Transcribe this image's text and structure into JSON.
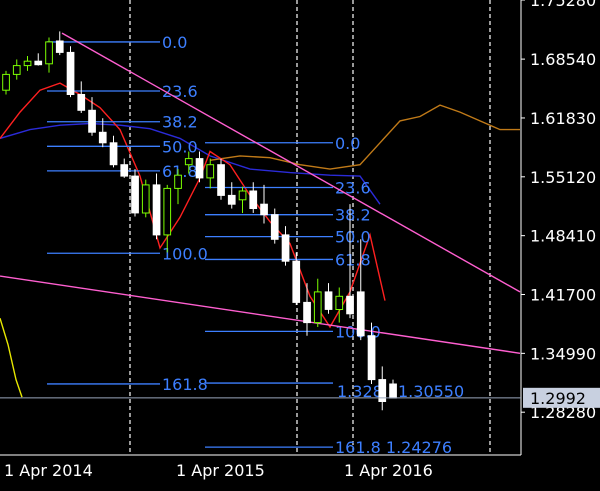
{
  "chart_data": {
    "type": "candlestick",
    "x_ticks": [
      "1 Apr 2014",
      "1 Apr 2015",
      "1 Apr 2016"
    ],
    "y_ticks": [
      "1.75280",
      "1.68540",
      "1.61830",
      "1.55120",
      "1.48410",
      "1.41700",
      "1.34990",
      "1.28280"
    ],
    "y_tick_values": [
      1.7528,
      1.6854,
      1.6183,
      1.5512,
      1.4841,
      1.417,
      1.3499,
      1.2828
    ],
    "ylim": [
      1.234,
      1.7528
    ],
    "current_price": {
      "value": 1.2992,
      "label": "1.2992"
    },
    "colors": {
      "background": "#000000",
      "bull": "#7cff00",
      "bear": "#ffffff",
      "fib": "#3d7fff",
      "fib_label": "#3d7fff",
      "trendline": "#ff5fd0",
      "ma_red": "#ff2020",
      "ma_blue": "#2b2bd8",
      "ma_orange": "#c07a18",
      "ma_yellow": "#e8e800",
      "axis_text": "#ffffff",
      "price_box": "#c8d0e0",
      "price_box_text": "#000000",
      "grid": "#ffffff"
    },
    "candles": [
      {
        "o": 1.65,
        "h": 1.672,
        "l": 1.645,
        "c": 1.668
      },
      {
        "o": 1.668,
        "h": 1.685,
        "l": 1.662,
        "c": 1.678
      },
      {
        "o": 1.678,
        "h": 1.689,
        "l": 1.672,
        "c": 1.683
      },
      {
        "o": 1.683,
        "h": 1.692,
        "l": 1.678,
        "c": 1.679
      },
      {
        "o": 1.68,
        "h": 1.71,
        "l": 1.67,
        "c": 1.705
      },
      {
        "o": 1.706,
        "h": 1.717,
        "l": 1.69,
        "c": 1.693
      },
      {
        "o": 1.693,
        "h": 1.7,
        "l": 1.642,
        "c": 1.645
      },
      {
        "o": 1.645,
        "h": 1.66,
        "l": 1.624,
        "c": 1.627
      },
      {
        "o": 1.627,
        "h": 1.642,
        "l": 1.598,
        "c": 1.602
      },
      {
        "o": 1.602,
        "h": 1.618,
        "l": 1.585,
        "c": 1.59
      },
      {
        "o": 1.59,
        "h": 1.598,
        "l": 1.562,
        "c": 1.565
      },
      {
        "o": 1.565,
        "h": 1.572,
        "l": 1.55,
        "c": 1.552
      },
      {
        "o": 1.552,
        "h": 1.56,
        "l": 1.506,
        "c": 1.51
      },
      {
        "o": 1.51,
        "h": 1.548,
        "l": 1.505,
        "c": 1.542
      },
      {
        "o": 1.542,
        "h": 1.555,
        "l": 1.48,
        "c": 1.485
      },
      {
        "o": 1.485,
        "h": 1.542,
        "l": 1.465,
        "c": 1.538
      },
      {
        "o": 1.538,
        "h": 1.56,
        "l": 1.52,
        "c": 1.553
      },
      {
        "o": 1.565,
        "h": 1.58,
        "l": 1.555,
        "c": 1.572
      },
      {
        "o": 1.572,
        "h": 1.58,
        "l": 1.545,
        "c": 1.55
      },
      {
        "o": 1.55,
        "h": 1.572,
        "l": 1.538,
        "c": 1.565
      },
      {
        "o": 1.565,
        "h": 1.572,
        "l": 1.525,
        "c": 1.53
      },
      {
        "o": 1.53,
        "h": 1.545,
        "l": 1.515,
        "c": 1.52
      },
      {
        "o": 1.525,
        "h": 1.54,
        "l": 1.51,
        "c": 1.535
      },
      {
        "o": 1.535,
        "h": 1.545,
        "l": 1.51,
        "c": 1.515
      },
      {
        "o": 1.52,
        "h": 1.542,
        "l": 1.498,
        "c": 1.508
      },
      {
        "o": 1.508,
        "h": 1.515,
        "l": 1.475,
        "c": 1.48
      },
      {
        "o": 1.485,
        "h": 1.495,
        "l": 1.45,
        "c": 1.455
      },
      {
        "o": 1.455,
        "h": 1.465,
        "l": 1.405,
        "c": 1.408
      },
      {
        "o": 1.408,
        "h": 1.43,
        "l": 1.37,
        "c": 1.385
      },
      {
        "o": 1.385,
        "h": 1.435,
        "l": 1.38,
        "c": 1.42
      },
      {
        "o": 1.42,
        "h": 1.43,
        "l": 1.395,
        "c": 1.4
      },
      {
        "o": 1.4,
        "h": 1.425,
        "l": 1.385,
        "c": 1.415
      },
      {
        "o": 1.415,
        "h": 1.52,
        "l": 1.39,
        "c": 1.395
      },
      {
        "o": 1.42,
        "h": 1.48,
        "l": 1.365,
        "c": 1.37
      },
      {
        "o": 1.37,
        "h": 1.385,
        "l": 1.315,
        "c": 1.32
      },
      {
        "o": 1.32,
        "h": 1.335,
        "l": 1.285,
        "c": 1.295
      },
      {
        "o": 1.315,
        "h": 1.32,
        "l": 1.299,
        "c": 1.299
      }
    ],
    "fib_sets": [
      {
        "levels": [
          {
            "label": "0.0",
            "price": 1.705,
            "x1": 47,
            "x2": 160,
            "label_x": 162
          },
          {
            "label": "23.6",
            "price": 1.649,
            "x1": 47,
            "x2": 160,
            "label_x": 162
          },
          {
            "label": "38.2",
            "price": 1.614,
            "x1": 47,
            "x2": 160,
            "label_x": 162
          },
          {
            "label": "50.0",
            "price": 1.586,
            "x1": 47,
            "x2": 160,
            "label_x": 162
          },
          {
            "label": "61.8",
            "price": 1.558,
            "x1": 47,
            "x2": 160,
            "label_x": 162
          },
          {
            "label": "100.0",
            "price": 1.464,
            "x1": 47,
            "x2": 160,
            "label_x": 162
          },
          {
            "label": "161.8",
            "price": 1.315,
            "x1": 47,
            "x2": 160,
            "label_x": 162
          }
        ]
      },
      {
        "levels": [
          {
            "label": "0.0",
            "price": 1.59,
            "x1": 205,
            "x2": 333,
            "label_x": 335
          },
          {
            "label": "23.6",
            "price": 1.539,
            "x1": 205,
            "x2": 333,
            "label_x": 335
          },
          {
            "label": "38.2",
            "price": 1.508,
            "x1": 205,
            "x2": 333,
            "label_x": 335
          },
          {
            "label": "50.0",
            "price": 1.483,
            "x1": 205,
            "x2": 333,
            "label_x": 335
          },
          {
            "label": "61.8",
            "price": 1.457,
            "x1": 205,
            "x2": 333,
            "label_x": 335
          },
          {
            "label": "100.0",
            "price": 1.375,
            "x1": 205,
            "x2": 333,
            "label_x": 335
          },
          {
            "label": "161.8 1.24276",
            "price": 1.243,
            "x1": 205,
            "x2": 333,
            "label_x": 335
          }
        ]
      }
    ],
    "extra_labels": [
      {
        "text": "1.328",
        "price": 1.307,
        "x": 337
      },
      {
        "text": "1.30550",
        "price": 1.307,
        "x": 398
      }
    ],
    "extra_levels": [
      {
        "price": 1.316,
        "x1": 205,
        "x2": 333
      }
    ],
    "trendlines": [
      {
        "x1": 62,
        "p1": 1.715,
        "x2": 520,
        "p2": 1.42
      },
      {
        "x1": 0,
        "p1": 1.438,
        "x2": 520,
        "p2": 1.35
      }
    ],
    "ma_red": [
      [
        0,
        1.595
      ],
      [
        20,
        1.625
      ],
      [
        40,
        1.65
      ],
      [
        60,
        1.658
      ],
      [
        80,
        1.645
      ],
      [
        100,
        1.63
      ],
      [
        120,
        1.605
      ],
      [
        140,
        1.552
      ],
      [
        160,
        1.47
      ],
      [
        180,
        1.505
      ],
      [
        200,
        1.55
      ],
      [
        210,
        1.58
      ],
      [
        230,
        1.565
      ],
      [
        250,
        1.53
      ],
      [
        270,
        1.5
      ],
      [
        290,
        1.475
      ],
      [
        310,
        1.415
      ],
      [
        330,
        1.38
      ],
      [
        350,
        1.42
      ],
      [
        370,
        1.485
      ],
      [
        385,
        1.41
      ]
    ],
    "ma_blue": [
      [
        0,
        1.595
      ],
      [
        30,
        1.605
      ],
      [
        60,
        1.61
      ],
      [
        90,
        1.612
      ],
      [
        120,
        1.61
      ],
      [
        150,
        1.606
      ],
      [
        180,
        1.595
      ],
      [
        210,
        1.575
      ],
      [
        250,
        1.56
      ],
      [
        290,
        1.556
      ],
      [
        330,
        1.553
      ],
      [
        360,
        1.552
      ],
      [
        380,
        1.52
      ]
    ],
    "ma_orange": [
      [
        210,
        1.57
      ],
      [
        240,
        1.575
      ],
      [
        270,
        1.573
      ],
      [
        300,
        1.565
      ],
      [
        330,
        1.56
      ],
      [
        360,
        1.565
      ],
      [
        380,
        1.59
      ],
      [
        400,
        1.615
      ],
      [
        420,
        1.62
      ],
      [
        440,
        1.633
      ],
      [
        460,
        1.625
      ],
      [
        480,
        1.615
      ],
      [
        500,
        1.605
      ],
      [
        520,
        1.605
      ]
    ],
    "ma_yellow": [
      [
        0,
        1.39
      ],
      [
        8,
        1.36
      ],
      [
        16,
        1.32
      ],
      [
        22,
        1.3
      ]
    ]
  }
}
